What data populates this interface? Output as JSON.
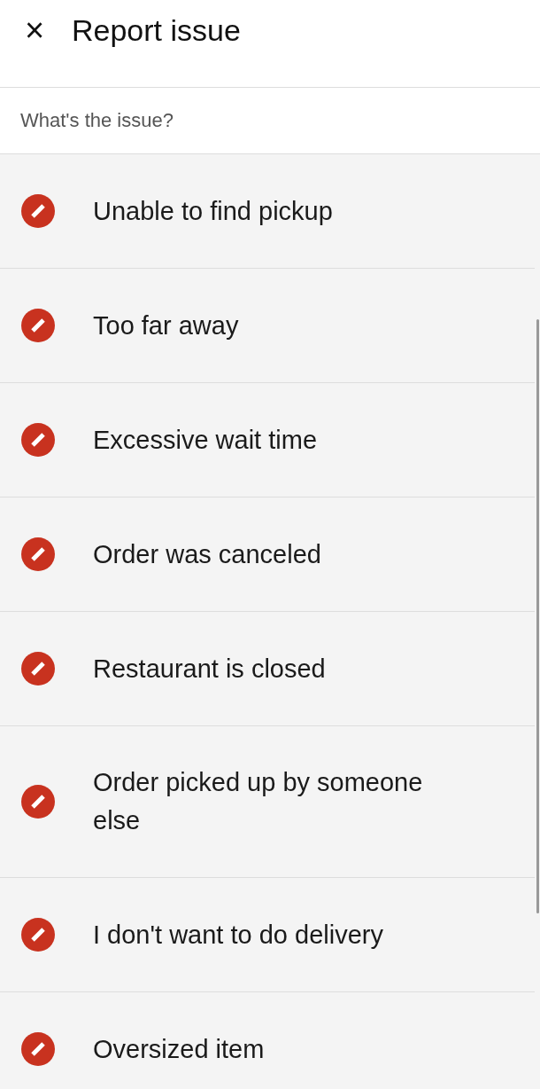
{
  "header": {
    "close": "×",
    "title": "Report issue"
  },
  "prompt": "What's the issue?",
  "issues": [
    {
      "label": "Unable to find pickup"
    },
    {
      "label": "Too far away"
    },
    {
      "label": "Excessive wait time"
    },
    {
      "label": "Order was canceled"
    },
    {
      "label": "Restaurant is closed"
    },
    {
      "label": "Order picked up by someone else"
    },
    {
      "label": "I don't want to do delivery"
    },
    {
      "label": "Oversized item"
    }
  ]
}
